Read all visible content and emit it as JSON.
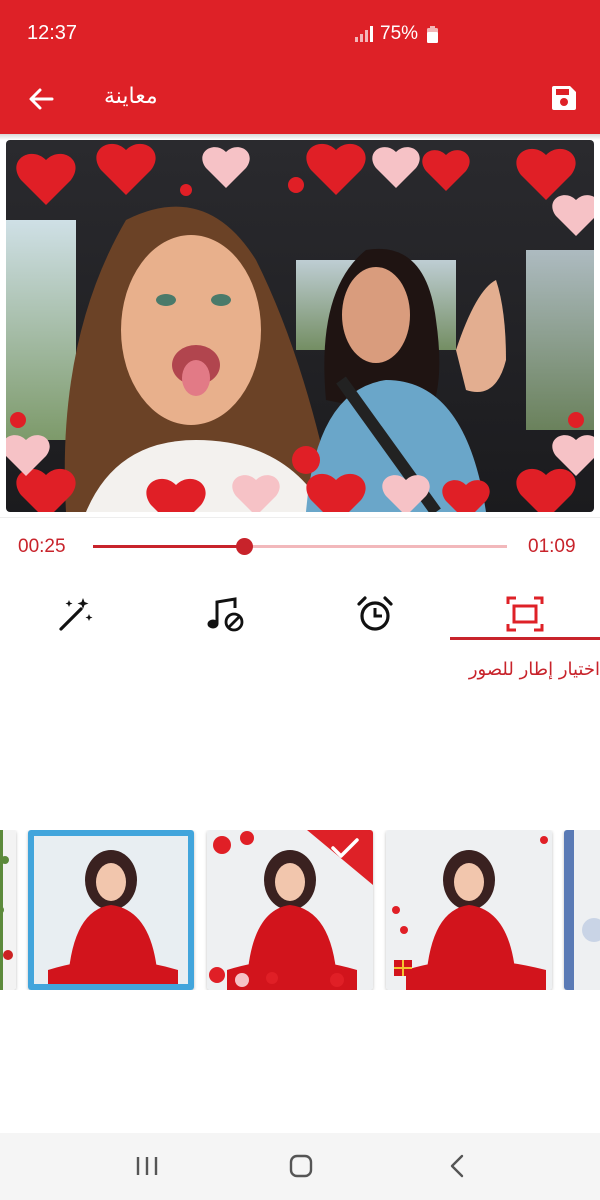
{
  "status": {
    "time": "12:37",
    "battery": "75%"
  },
  "appbar": {
    "title": "معاينة"
  },
  "player": {
    "current_time": "00:25",
    "total_time": "01:09",
    "progress": 0.365
  },
  "tools": [
    {
      "name": "effects",
      "icon": "magic-wand-icon"
    },
    {
      "name": "music",
      "icon": "music-note-icon"
    },
    {
      "name": "duration",
      "icon": "alarm-clock-icon"
    },
    {
      "name": "frame",
      "icon": "frame-icon",
      "active": true
    }
  ],
  "active_tool_label": "اختيار إطار للصور",
  "frames": [
    {
      "style": "leaf-border",
      "selected": false
    },
    {
      "style": "blue-frost",
      "selected": false
    },
    {
      "style": "red-hearts",
      "selected": true
    },
    {
      "style": "christmas",
      "selected": false
    },
    {
      "style": "blue-edge",
      "selected": false
    }
  ],
  "colors": {
    "accent": "#de2127",
    "accent_dark": "#c8232b",
    "track": "#f2b8bb"
  }
}
